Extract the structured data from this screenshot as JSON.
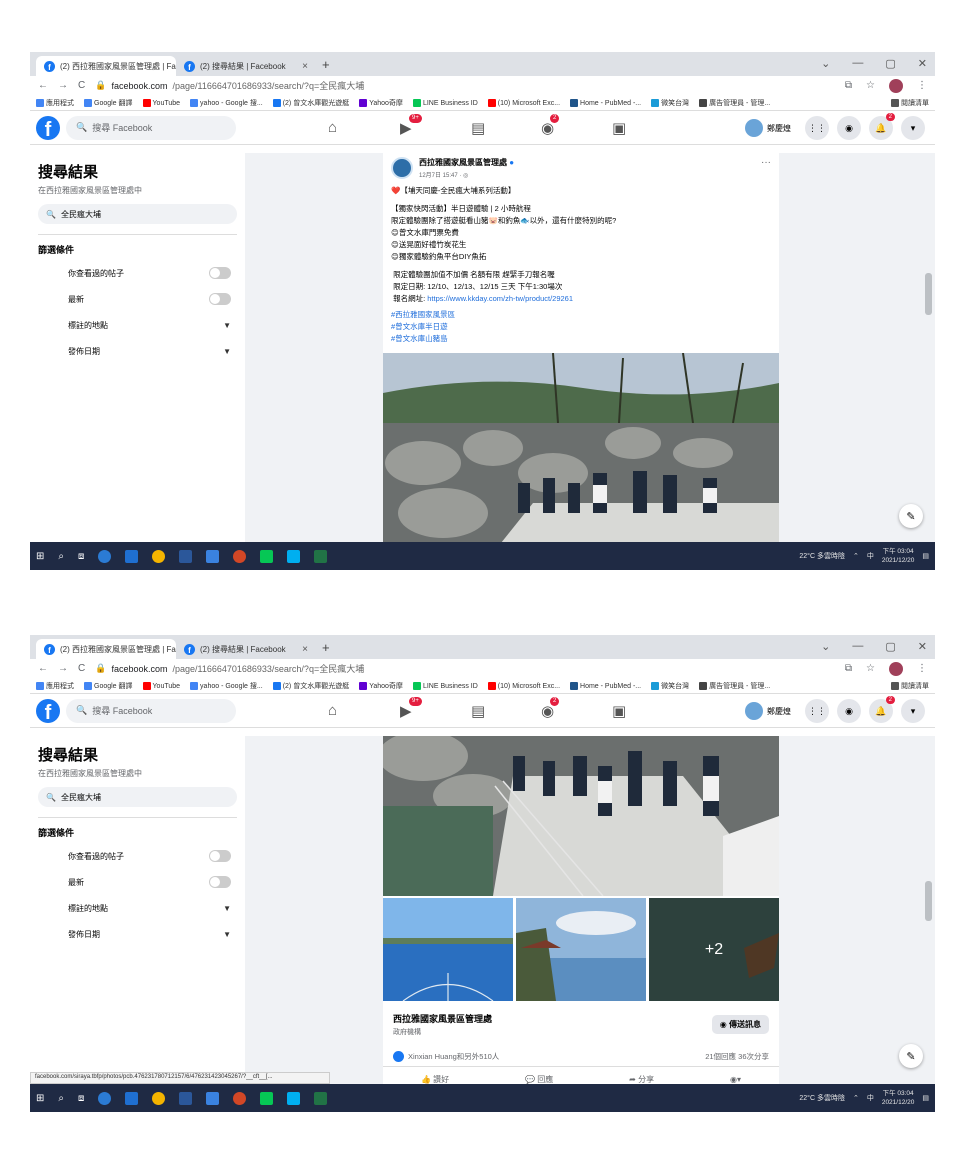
{
  "browser": {
    "tabs": [
      {
        "label": "(2) 西拉雅國家風景區管理處 | Fa",
        "close": "×"
      },
      {
        "label": "(2) 搜尋結果 | Facebook",
        "close": "×"
      }
    ],
    "new_tab": "+",
    "window_controls": [
      "⌄",
      "—",
      "▢",
      "✕"
    ],
    "url_host": "facebook.com",
    "url_path": "/page/116664701686933/search/?q=全民瘋大埔",
    "nav": {
      "back": "←",
      "forward": "→",
      "reload": "C"
    },
    "bookmarks": [
      {
        "label": "應用程式",
        "color": "#4285f4"
      },
      {
        "label": "Google 翻譯",
        "color": "#4285f4"
      },
      {
        "label": "YouTube",
        "color": "#ff0000"
      },
      {
        "label": "yahoo - Google 搜...",
        "color": "#4285f4"
      },
      {
        "label": "(2) 曾文水庫觀光遊艇",
        "color": "#1877f2"
      },
      {
        "label": "Yahoo奇摩",
        "color": "#6001d2"
      },
      {
        "label": "LINE Business ID",
        "color": "#06c755"
      },
      {
        "label": "(10) Microsoft Exc...",
        "color": "#ff0000"
      },
      {
        "label": "Home - PubMed -...",
        "color": "#20558a"
      },
      {
        "label": "微笑台灣",
        "color": "#1a9bd7"
      },
      {
        "label": "廣告管理員 - 管理...",
        "color": "#444444"
      }
    ],
    "reading_list": "閱讀清單"
  },
  "fb_header": {
    "logo": "f",
    "search_placeholder": "搜尋 Facebook",
    "nav_icons": [
      {
        "name": "home-icon",
        "glyph": "⌂",
        "badge": ""
      },
      {
        "name": "watch-icon",
        "glyph": "▶",
        "badge": "9+"
      },
      {
        "name": "marketplace-icon",
        "glyph": "▤",
        "badge": ""
      },
      {
        "name": "groups-icon",
        "glyph": "◉",
        "badge": "2"
      },
      {
        "name": "gaming-icon",
        "glyph": "▣",
        "badge": ""
      }
    ],
    "user_name": "鄭慶煌",
    "menu_icon": "⋮⋮",
    "messenger_icon": "◉",
    "notif_badge": "2",
    "account_icon": "▾"
  },
  "sidebar": {
    "title": "搜尋結果",
    "subtitle": "在西拉雅國家風景區管理處中",
    "search_value": "全民瘋大埔",
    "filters_title": "篩選條件",
    "filters": [
      {
        "label": "你查看過的帖子",
        "control": "toggle"
      },
      {
        "label": "最新",
        "control": "toggle"
      },
      {
        "label": "標註的地點",
        "control": "caret"
      },
      {
        "label": "發佈日期",
        "control": "caret"
      }
    ]
  },
  "post": {
    "page_name": "西拉雅國家風景區管理處",
    "date": "12月7日 15:47 · ◎",
    "more": "···",
    "lines": [
      "❤️【埔天同慶-全民瘋大埔系列活動】",
      "",
      "【獨家快閃活動】半日遊體驗 | 2 小時航程",
      "限定體驗團除了搭遊艇看山豬🐷和釣魚🐟以外，還有什麼特別的呢?",
      "😊曾文水庫門票免費",
      "😊送晃面好禮竹炭花生",
      "😊獨家體驗釣魚平台DIY魚拓",
      "",
      " 限定體驗團加值不加價 名額有限 趕緊手刀報名喔",
      " 限定日期: 12/10、12/13、12/15 三天 下午1:30場次",
      " 報名網址: "
    ],
    "link": "https://www.kkday.com/zh-tw/product/29261",
    "hashtags": [
      "#西拉雅國家風景區",
      "#曾文水庫半日遊",
      "#曾文水庫山豬島"
    ],
    "more_photos": "+2",
    "info_name": "西拉雅國家風景區管理處",
    "info_category": "政府機構",
    "message_button": "傳送訊息",
    "reactions": "Xinxian Huang和另外510人",
    "comments_shares": "21個回應 36次分享",
    "like": "讚好",
    "comment": "回應",
    "share": "分享"
  },
  "status_url": "facebook.com/siraya.tbfp/photos/pcb.476231780712157/6/476231423045267/?__cft__[...",
  "taskbar": {
    "weather": "22°C 多雲時陰",
    "ime": "中",
    "time": "下午 03:04",
    "date": "2021/12/20",
    "notif": "2"
  }
}
